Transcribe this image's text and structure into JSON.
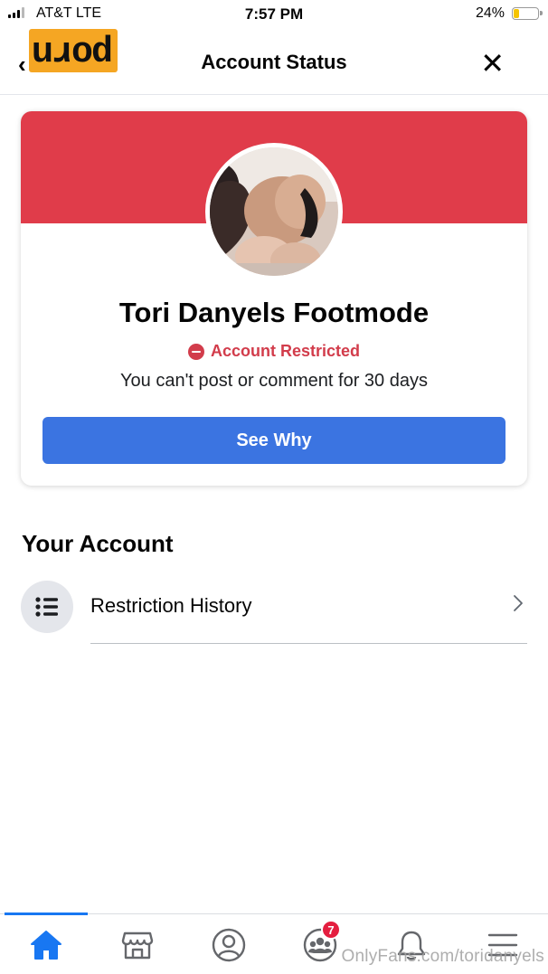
{
  "status_bar": {
    "carrier": "AT&T   LTE",
    "time": "7:57 PM",
    "battery_percent": "24%",
    "battery_level": 0.24,
    "battery_color": "#f5c400"
  },
  "header": {
    "back_icon": "chevron-left-icon",
    "logo_text": "porn",
    "logo_color": "#f5a623",
    "title": "Account Status",
    "close_icon": "close-icon"
  },
  "status_card": {
    "banner_color": "#e03c4a",
    "profile_name": "Tori Danyels Footmode",
    "status_icon": "restricted-icon",
    "status_label": "Account Restricted",
    "status_color": "#d23c4b",
    "description": "You can't post or comment for 30 days",
    "button_label": "See Why",
    "button_color": "#3b74e1"
  },
  "your_account": {
    "title": "Your Account",
    "items": [
      {
        "label": "Restriction History",
        "icon": "list-icon",
        "chevron": "chevron-right-icon"
      }
    ]
  },
  "bottom_nav": {
    "active_color": "#1877f2",
    "items": [
      {
        "icon": "home-icon",
        "active": true
      },
      {
        "icon": "marketplace-icon",
        "active": false
      },
      {
        "icon": "profile-icon",
        "active": false
      },
      {
        "icon": "groups-icon",
        "active": false,
        "badge": "7"
      },
      {
        "icon": "bell-icon",
        "active": false
      },
      {
        "icon": "menu-icon",
        "active": false
      }
    ],
    "badge_color": "#e41e3f"
  },
  "watermark": "OnlyFans.com/toridanyels"
}
